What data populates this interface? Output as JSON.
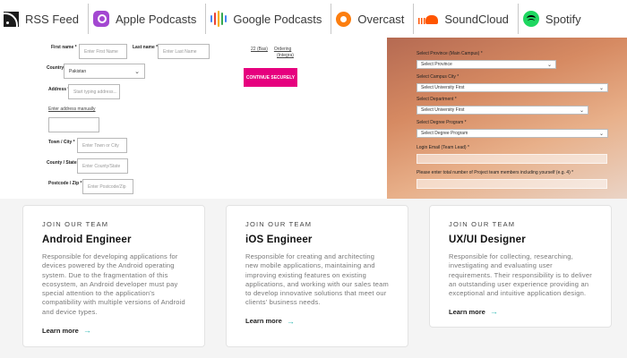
{
  "podcasts": [
    {
      "label": "RSS Feed",
      "icon": "rss-icon"
    },
    {
      "label": "Apple Podcasts",
      "icon": "apple-podcasts-icon"
    },
    {
      "label": "Google Podcasts",
      "icon": "google-podcasts-icon"
    },
    {
      "label": "Overcast",
      "icon": "overcast-icon"
    },
    {
      "label": "SoundCloud",
      "icon": "soundcloud-icon"
    },
    {
      "label": "Spotify",
      "icon": "spotify-icon"
    }
  ],
  "colors": {
    "apple": "#a347d1",
    "google": [
      "#f9ab00",
      "#34a853",
      "#4285f4",
      "#ea4335"
    ],
    "overcast": "#fc7e0f",
    "soundcloud": "#ff5500",
    "spotify": "#1ed760",
    "checkout_button": "#e6007e",
    "learn_more_arrow": "#29b6b0"
  },
  "address_form": {
    "first_name_label": "First name *",
    "first_name_placeholder": "Enter First Name",
    "last_name_label": "Last name *",
    "last_name_placeholder": "Enter Last Name",
    "country_label": "Country *",
    "country_value": "Pakistan",
    "address_label": "Address *",
    "address_placeholder": "Start typing address...",
    "enter_manually_link": "Enter address manually",
    "town_label": "Town / City *",
    "town_placeholder": "Enter Town or City",
    "county_label": "County / State",
    "county_placeholder": "Enter County/State",
    "postcode_label": "Postcode / Zip *",
    "postcode_placeholder": "Enter Postcode/Zip",
    "side_link_1": "22 (Bas)",
    "side_link_2": "Ordering",
    "side_link_2b": "(Integra)",
    "continue_button": "CONTINUE SECURELY"
  },
  "registration_form": {
    "province_label": "Select Province (Main Campus) *",
    "province_value": "Select Province",
    "city_label": "Select Campus City *",
    "city_value": "Select University First",
    "department_label": "Select Department *",
    "department_value": "Select University First",
    "program_label": "Select Degree Program *",
    "program_value": "Select Degree Program",
    "email_label": "Login Email (Team Lead) *",
    "members_label": "Please enter total number of Project team members including yourself (e.g. 4) *"
  },
  "jobs": [
    {
      "kicker": "JOIN OUR TEAM",
      "title": "Android Engineer",
      "description": "Responsible for developing applications for devices powered by the Android operating system. Due to the fragmentation of this ecosystem, an Android developer must pay special attention to the application's compatibility with multiple versions of Android and device types.",
      "link": "Learn more"
    },
    {
      "kicker": "JOIN OUR TEAM",
      "title": "iOS Engineer",
      "description": "Responsible for creating and architecting new mobile applications, maintaining and improving existing features on existing applications, and working with our sales team to develop innovative solutions that meet our clients' business needs.",
      "link": "Learn more"
    },
    {
      "kicker": "JOIN OUR TEAM",
      "title": "UX/UI Designer",
      "description": "Responsible for collecting, researching, investigating and evaluating user requirements. Their responsibility is to deliver an outstanding user experience providing an exceptional and intuitive application design.",
      "link": "Learn more"
    }
  ]
}
